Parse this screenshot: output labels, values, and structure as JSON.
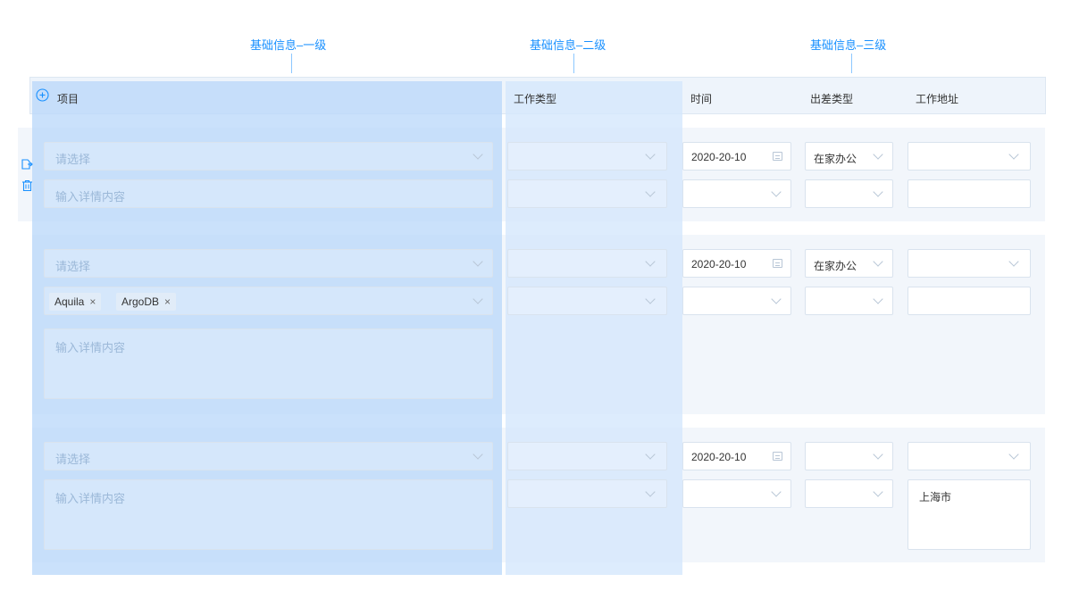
{
  "annotations": {
    "level1": "基础信息–一级",
    "level2": "基础信息–二级",
    "level3": "基础信息–三级"
  },
  "header": {
    "add_icon": "plus-circle-icon",
    "project": "项目",
    "work_type": "工作类型",
    "time": "时间",
    "trip_type": "出差类型",
    "work_address": "工作地址"
  },
  "rows": [
    {
      "project_select_placeholder": "请选择",
      "detail_placeholder": "输入详情内容",
      "date": "2020-20-10",
      "trip_type": "在家办公"
    },
    {
      "project_select_placeholder": "请选择",
      "tags": [
        "Aquila",
        "ArgoDB"
      ],
      "detail_placeholder": "输入详情内容",
      "date": "2020-20-10",
      "trip_type": "在家办公"
    },
    {
      "project_select_placeholder": "请选择",
      "detail_placeholder": "输入详情内容",
      "date": "2020-20-10",
      "address": "上海市"
    }
  ],
  "colors": {
    "accent": "#1890ff",
    "level1_overlay": "#b8d7fa",
    "level2_overlay": "#d4e7fc",
    "group_bg": "#f2f6fb"
  }
}
